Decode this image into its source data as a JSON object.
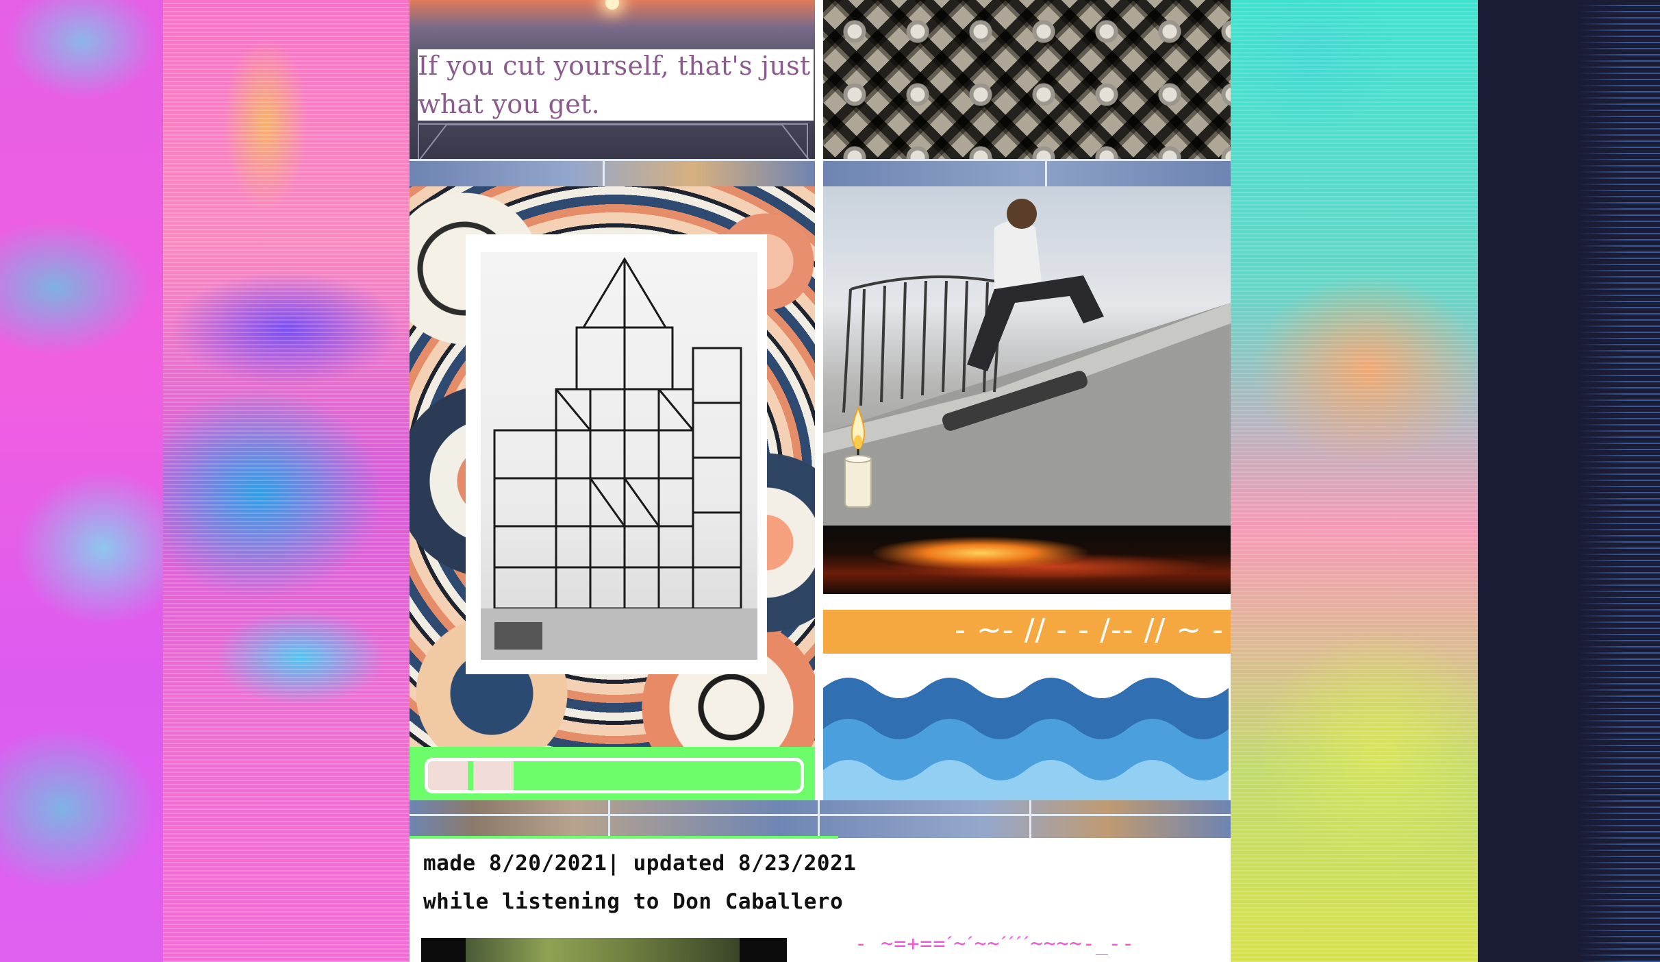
{
  "quote": {
    "text": "If you cut yourself, that's just what you get."
  },
  "banner": {
    "text": "- ~- // - - /-- // ~ -"
  },
  "loader": {
    "progress": 0.23,
    "track_color": "#6efd6a",
    "fill_color": "#f2dcd8"
  },
  "footer": {
    "made_text": "made 8/20/2021| updated 8/23/2021",
    "listening_text": "while listening to Don Caballero",
    "ascii_text": "- ~=+==ˊ~ˊ~~ˊˊˊˊ~~~~-_--"
  },
  "colors": {
    "accent_green": "#6efd6a",
    "banner_orange": "#f5a840",
    "quote_purple": "#8b5b8d",
    "ascii_magenta": "#f056d6",
    "page_dark": "#1c1d36"
  },
  "images": {
    "sunset": "sunset-photo",
    "lattice": "lattice-screen-photo",
    "swirl": "abstract-swirl-art",
    "scaffold": "scaffold-tower-photo",
    "skater": "skateboarder-photo",
    "candle": "candle-icon",
    "fire": "fire-glow-strip",
    "waves": "waves-graphic"
  }
}
